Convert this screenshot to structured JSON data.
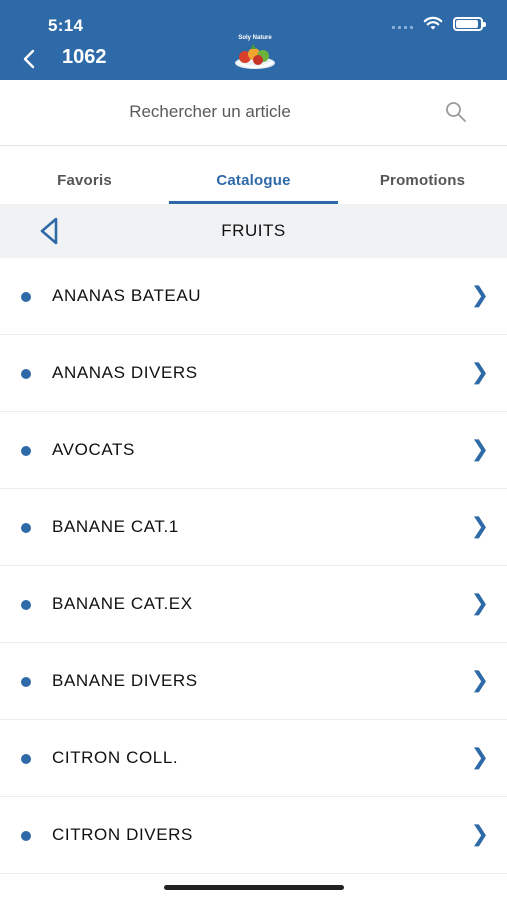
{
  "status_bar": {
    "time": "5:14"
  },
  "nav": {
    "title": "1062",
    "logo_text": "Soly Nature"
  },
  "search": {
    "placeholder": "Rechercher un article"
  },
  "tabs": [
    {
      "label": "Favoris",
      "active": false
    },
    {
      "label": "Catalogue",
      "active": true
    },
    {
      "label": "Promotions",
      "active": false
    }
  ],
  "category": {
    "title": "FRUITS"
  },
  "items": [
    {
      "label": "ANANAS BATEAU"
    },
    {
      "label": "ANANAS DIVERS"
    },
    {
      "label": "AVOCATS"
    },
    {
      "label": "BANANE CAT.1"
    },
    {
      "label": "BANANE CAT.EX"
    },
    {
      "label": "BANANE DIVERS"
    },
    {
      "label": "CITRON COLL."
    },
    {
      "label": "CITRON DIVERS"
    }
  ],
  "colors": {
    "primary": "#2f6aa8",
    "category_bg": "#f1f2f4"
  },
  "icons": {
    "row_chevron": "❯"
  }
}
